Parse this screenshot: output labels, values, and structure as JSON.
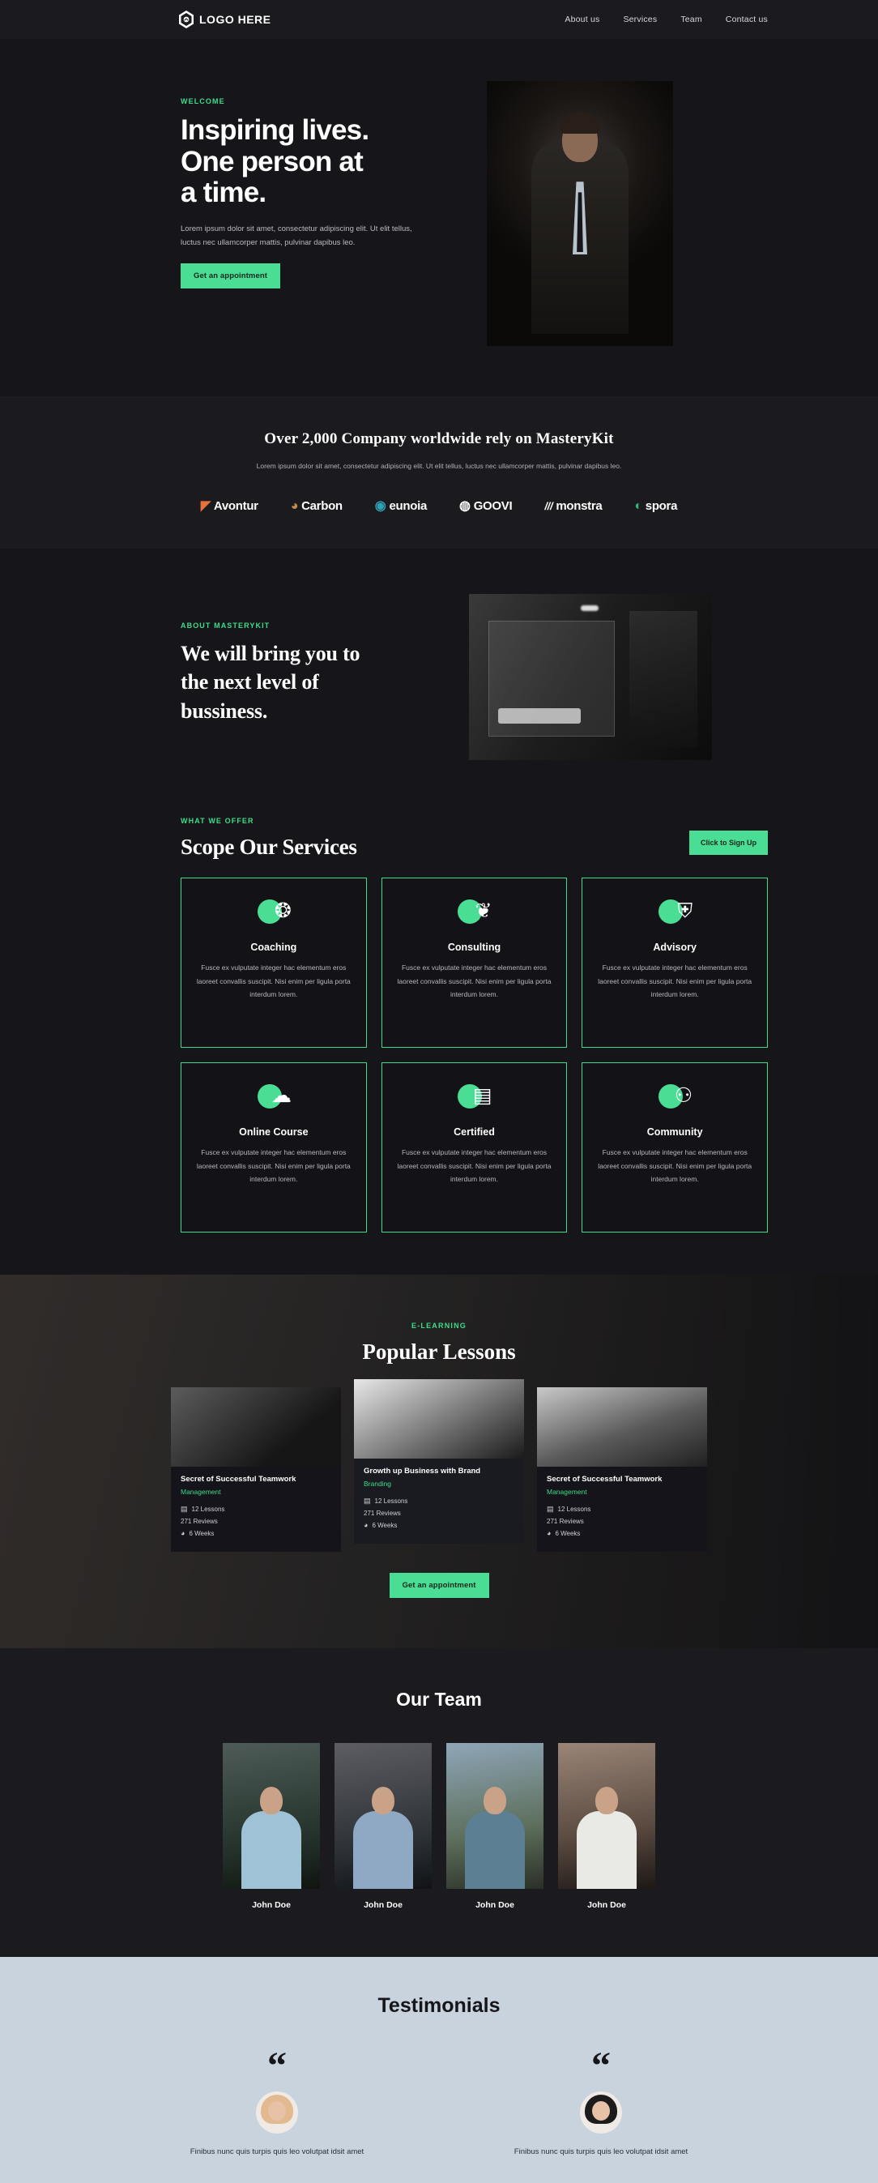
{
  "nav": {
    "logo_icon": "hexagon-logo-icon",
    "brand": "LOGO HERE",
    "links": [
      {
        "label": "About us"
      },
      {
        "label": "Services"
      },
      {
        "label": "Team"
      },
      {
        "label": "Contact us"
      }
    ]
  },
  "hero": {
    "eyebrow": "WELCOME",
    "title_line1": "Inspiring lives.",
    "title_line2": "One person at",
    "title_line3": "a time.",
    "paragraph": "Lorem ipsum dolor sit amet, consectetur adipiscing elit. Ut elit tellus, luctus nec ullamcorper mattis, pulvinar dapibus leo.",
    "cta": "Get an appointment",
    "image_alt": "man-in-suit-photo"
  },
  "clients": {
    "title": "Over 2,000 Company worldwide rely on MasteryKit",
    "subtitle": "Lorem ipsum dolor sit amet, consectetur adipiscing elit. Ut elit tellus, luctus nec ullamcorper mattis, pulvinar dapibus leo.",
    "logos": [
      {
        "glyph": "◤",
        "name": "Avontur",
        "color": "#e8703a"
      },
      {
        "glyph": "◕",
        "name": "Carbon",
        "color": "#c98a4b"
      },
      {
        "glyph": "◉",
        "name": "eunoia",
        "color": "#2f9fb5"
      },
      {
        "glyph": "◍",
        "name": "GOOVI",
        "color": "#ffffff"
      },
      {
        "glyph": "///",
        "name": "monstra",
        "color": "#ffffff"
      },
      {
        "glyph": "◐",
        "name": "spora",
        "color": "#2fb87a"
      }
    ]
  },
  "about": {
    "eyebrow": "ABOUT MASTERYKIT",
    "title_line1": "We will bring you to",
    "title_line2": "the next level of",
    "title_line3": "bussiness.",
    "image_alt": "office-meeting-photo"
  },
  "services": {
    "eyebrow": "WHAT WE OFFER",
    "title": "Scope Our Services",
    "cta": "Click to Sign Up",
    "description": "Fusce ex vulputate integer hac elementum eros laoreet convallis suscipit. Nisi enim per ligula porta interdum lorem.",
    "cards": [
      {
        "icon": "laurel-star-icon",
        "glyph": "❂",
        "name": "Coaching"
      },
      {
        "icon": "people-stars-icon",
        "glyph": "❦",
        "name": "Consulting"
      },
      {
        "icon": "shield-icon",
        "glyph": "⛨",
        "name": "Advisory"
      },
      {
        "icon": "cloud-devices-icon",
        "glyph": "☁",
        "name": "Online Course"
      },
      {
        "icon": "certificate-icon",
        "glyph": "▤",
        "name": "Certified"
      },
      {
        "icon": "community-chat-icon",
        "glyph": "⚇",
        "name": "Community"
      }
    ]
  },
  "lessons": {
    "eyebrow": "E-LEARNING",
    "title": "Popular Lessons",
    "cta": "Get an appointment",
    "cards": [
      {
        "thumb": "teamwork-dark-photo",
        "name": "Secret of Successful Teamwork",
        "category": "Management",
        "lessons": "12 Lessons",
        "reviews": "271 Reviews",
        "duration": "6 Weeks"
      },
      {
        "thumb": "laptop-hands-photo",
        "name": "Growth up Business with Brand",
        "category": "Branding",
        "lessons": "12 Lessons",
        "reviews": "271 Reviews",
        "duration": "6 Weeks"
      },
      {
        "thumb": "team-meeting-photo",
        "name": "Secret of Successful Teamwork",
        "category": "Management",
        "lessons": "12 Lessons",
        "reviews": "271 Reviews",
        "duration": "6 Weeks"
      }
    ],
    "meta_icons": {
      "lessons_icon": "book-icon",
      "lessons_glyph": "▤",
      "duration_icon": "clock-icon",
      "duration_glyph": "◕"
    }
  },
  "team": {
    "title": "Our Team",
    "members": [
      {
        "name": "John Doe",
        "photo": "man-blue-shirt-photo"
      },
      {
        "name": "John Doe",
        "photo": "man-denim-jacket-photo"
      },
      {
        "name": "John Doe",
        "photo": "man-cap-patterned-shirt-photo"
      },
      {
        "name": "John Doe",
        "photo": "man-glasses-white-tee-photo"
      }
    ]
  },
  "testimonials": {
    "title": "Testimonials",
    "quote_glyph": "“",
    "items": [
      {
        "avatar": "blonde-woman-glasses-photo",
        "text": "Finibus nunc quis turpis quis leo volutpat idsit amet"
      },
      {
        "avatar": "dark-curly-hair-woman-photo",
        "text": "Finibus nunc quis turpis quis leo volutpat idsit amet"
      }
    ]
  },
  "colors": {
    "accent": "#4ade94",
    "accent_text": "#3ddc8a",
    "bg_dark": "#16161a",
    "bg_panel": "#1b1b1f",
    "testimonial_bg": "#c8d3de"
  }
}
